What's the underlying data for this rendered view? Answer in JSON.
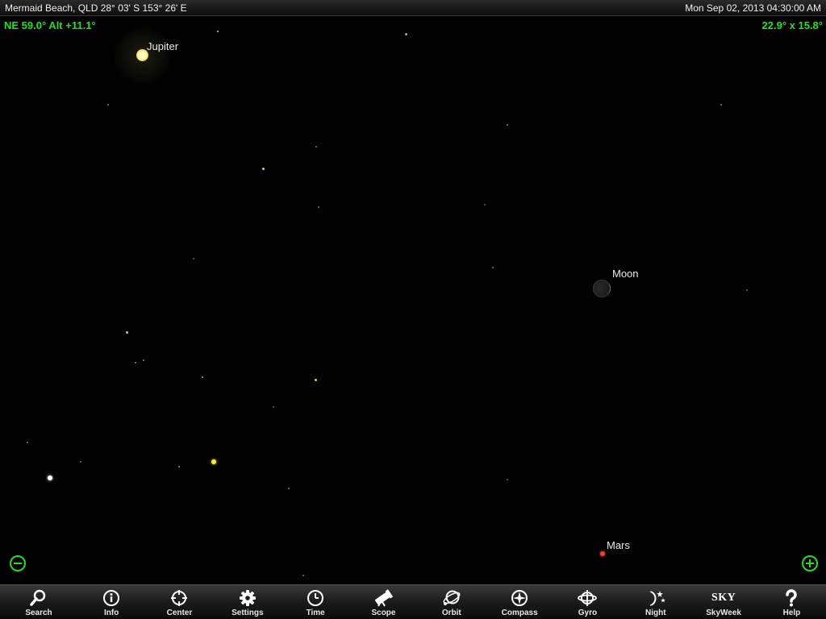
{
  "status_bar": {
    "location": "Mermaid Beach, QLD  28° 03' S 153° 26' E",
    "datetime": "Mon Sep 02, 2013  04:30:00 AM"
  },
  "hud": {
    "direction": "NE 59.0° Alt +11.1°",
    "field_of_view": "22.9° x 15.8°"
  },
  "objects": {
    "jupiter": "Jupiter",
    "moon": "Moon",
    "mars": "Mars"
  },
  "zoom": {
    "out_icon": "zoom-out-icon",
    "in_icon": "zoom-in-icon"
  },
  "toolbar": {
    "items": [
      {
        "label": "Search",
        "icon": "search-icon"
      },
      {
        "label": "Info",
        "icon": "info-icon"
      },
      {
        "label": "Center",
        "icon": "crosshair-icon"
      },
      {
        "label": "Settings",
        "icon": "gear-icon"
      },
      {
        "label": "Time",
        "icon": "clock-icon"
      },
      {
        "label": "Scope",
        "icon": "telescope-icon"
      },
      {
        "label": "Orbit",
        "icon": "orbit-icon"
      },
      {
        "label": "Compass",
        "icon": "compass-icon"
      },
      {
        "label": "Gyro",
        "icon": "gyro-icon"
      },
      {
        "label": "Night",
        "icon": "night-icon"
      },
      {
        "label": "SkyWeek",
        "icon": "skyweek-logo-icon",
        "logo_text": "SKY"
      },
      {
        "label": "Help",
        "icon": "help-icon"
      }
    ]
  },
  "colors": {
    "hud_green": "#22e022",
    "mars_red": "#e8402a",
    "jupiter_yellow": "#fbf5a0"
  }
}
